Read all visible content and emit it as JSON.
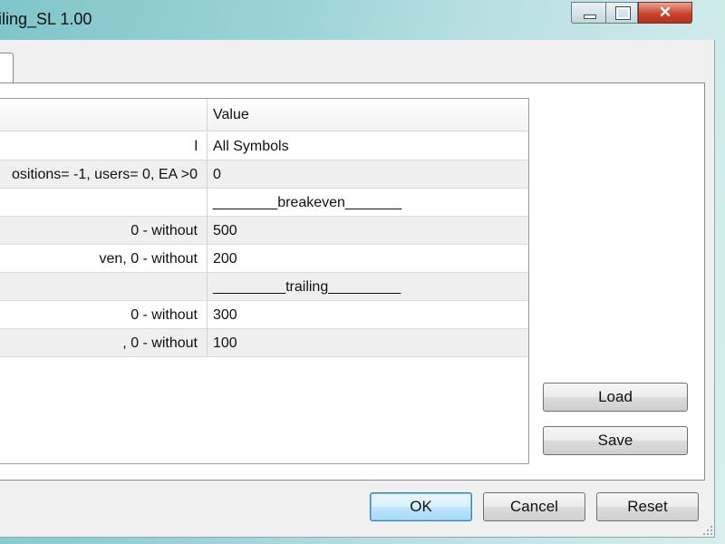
{
  "window": {
    "title": "iling_SL 1.00",
    "controls": {
      "minimize_icon": "minimize-icon",
      "maximize_icon": "maximize-icon",
      "close_glyph": "✕"
    }
  },
  "grid": {
    "header": {
      "variable": "",
      "value": "Value"
    },
    "rows": [
      {
        "variable": "l",
        "value": "All Symbols"
      },
      {
        "variable": "ositions= -1, users= 0, EA >0",
        "value": "0"
      },
      {
        "variable": "",
        "value": "________breakeven_______"
      },
      {
        "variable": "0 - without",
        "value": "500"
      },
      {
        "variable": "ven, 0 - without",
        "value": "200"
      },
      {
        "variable": "",
        "value": "_________trailing_________"
      },
      {
        "variable": "0 - without",
        "value": "300"
      },
      {
        "variable": ", 0 - without",
        "value": "100"
      }
    ]
  },
  "side_buttons": {
    "load": "Load",
    "save": "Save"
  },
  "footer_buttons": {
    "ok": "OK",
    "cancel": "Cancel",
    "reset": "Reset"
  },
  "colors": {
    "default_button_border": "#3c7fb1",
    "close_button": "#c9432c"
  }
}
